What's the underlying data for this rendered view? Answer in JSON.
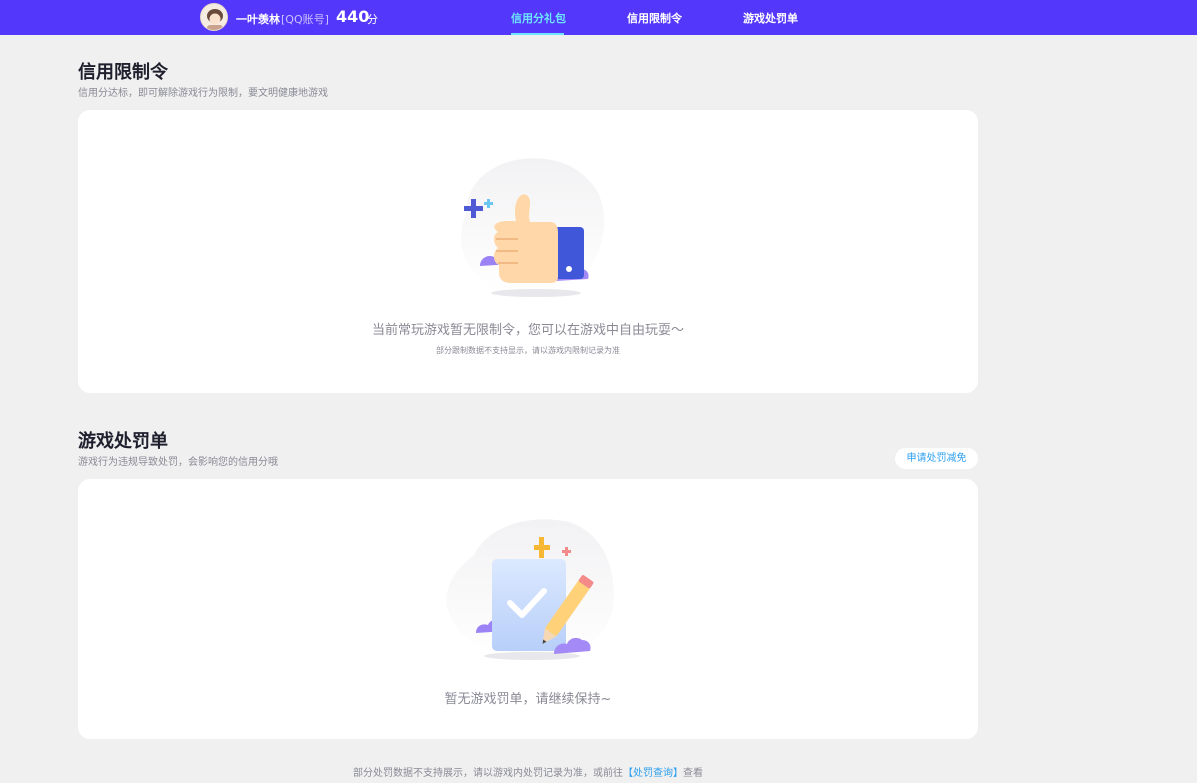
{
  "header": {
    "username": "一叶羡林",
    "account_type": "[QQ账号]",
    "score": "440",
    "score_unit": "分",
    "tabs": [
      {
        "label": "信用分礼包",
        "active": true
      },
      {
        "label": "信用限制令",
        "active": false
      },
      {
        "label": "游戏处罚单",
        "active": false
      }
    ],
    "colors": {
      "bar": "#5337fb",
      "active_tab": "#6de3ff"
    }
  },
  "restriction": {
    "title": "信用限制令",
    "subtitle": "信用分达标，即可解除游戏行为限制，要文明健康地游戏",
    "empty_message": "当前常玩游戏暂无限制令，您可以在游戏中自由玩耍～",
    "note": "部分跟制数据不支持显示，请以游戏内限制记录为准",
    "illustration_icon": "thumbs-up-icon"
  },
  "penalty": {
    "title": "游戏处罚单",
    "subtitle": "游戏行为违规导致处罚，会影响您的信用分哦",
    "appeal_button": "申请处罚减免",
    "empty_message": "暂无游戏罚单，请继续保持~",
    "illustration_icon": "clipboard-check-icon"
  },
  "footer": {
    "text_before": "部分处罚数据不支持展示，请以游戏内处罚记录为准，或前往",
    "link": "【处罚查询】",
    "text_after": "查看"
  }
}
